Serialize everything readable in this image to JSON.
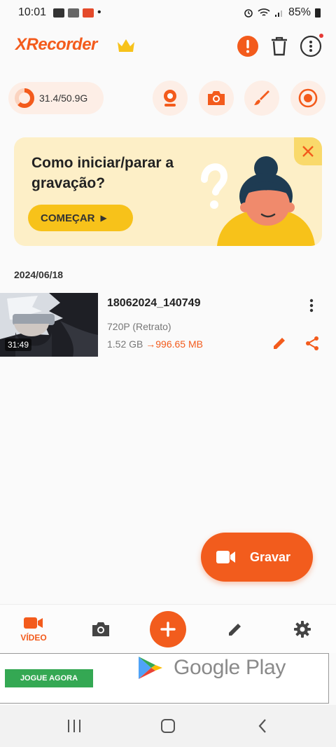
{
  "status_bar": {
    "time": "10:01",
    "dot": "•",
    "battery": "85%"
  },
  "header": {
    "app_name": "XRecorder",
    "icons": [
      "crown-icon",
      "alert-icon",
      "trash-icon",
      "more-icon"
    ]
  },
  "toolbar": {
    "storage": "31.4/50.9G",
    "storage_used_fraction": 0.62,
    "buttons": [
      "webcam-icon",
      "camera-icon",
      "brush-icon",
      "record-icon"
    ]
  },
  "banner": {
    "title": "Como iniciar/parar a gravação?",
    "cta": "COMEÇAR",
    "cta_arrow": "▶"
  },
  "recordings": {
    "date": "2024/06/18",
    "items": [
      {
        "name": "18062024_140749",
        "resolution": "720P (Retrato)",
        "size_original": "1.52 GB",
        "size_arrow": "→",
        "size_compressed": "996.65 MB",
        "duration": "31:49"
      }
    ]
  },
  "fab": {
    "label": "Gravar"
  },
  "bottom_nav": {
    "video_label": "VÍDEO",
    "items": [
      "video-icon",
      "camera-icon",
      "plus-icon",
      "edit-icon",
      "settings-icon"
    ]
  },
  "ad": {
    "button": "JOGUE AGORA",
    "store": "Google Play"
  },
  "colors": {
    "accent": "#f35b1c",
    "banner_bg": "#fdefc7",
    "cta_yellow": "#f7c21a"
  }
}
